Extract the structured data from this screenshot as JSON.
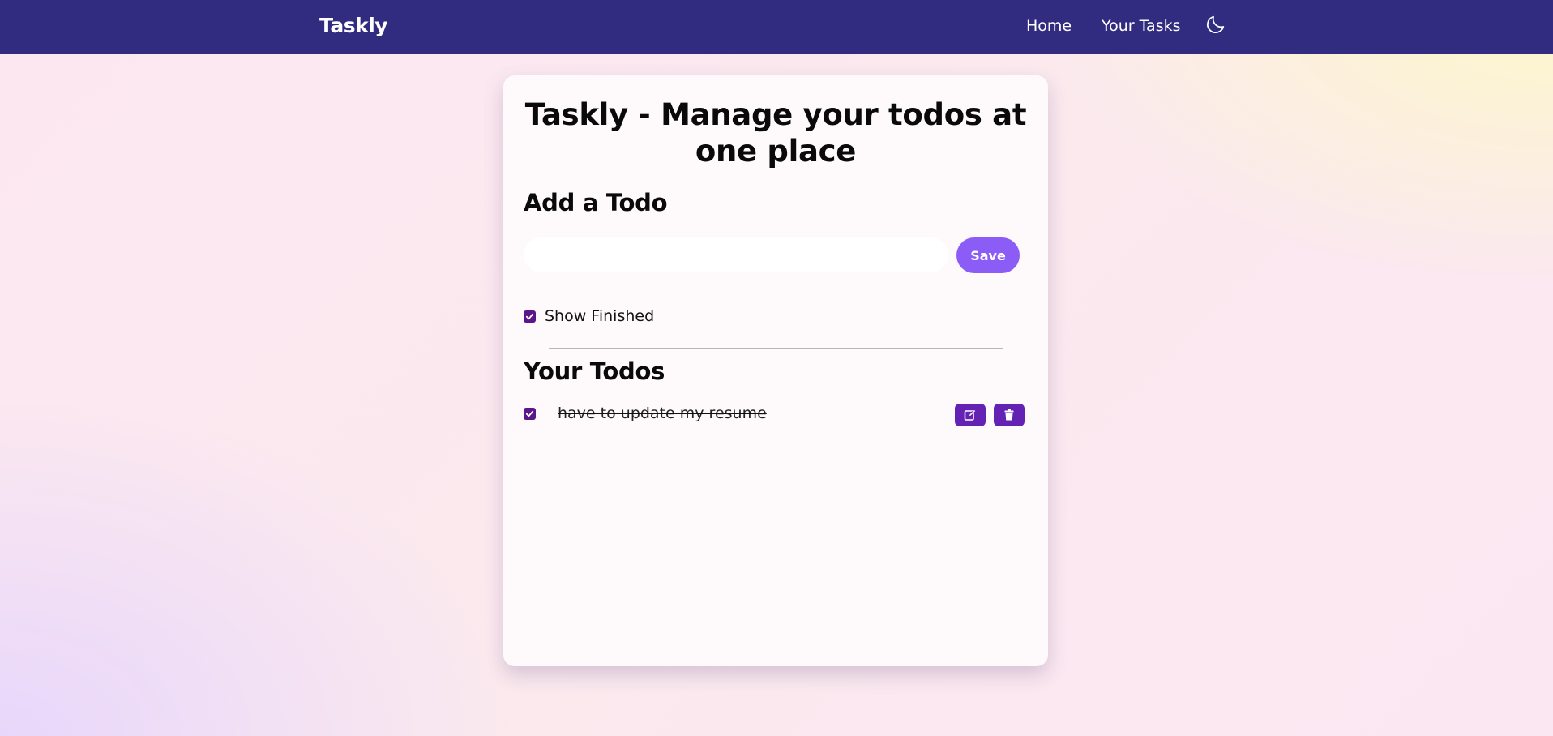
{
  "navbar": {
    "brand": "Taskly",
    "links": [
      {
        "label": "Home"
      },
      {
        "label": "Your Tasks"
      }
    ],
    "theme_toggle_icon": "moon-icon",
    "background_color": "#312c80"
  },
  "main": {
    "title": "Taskly - Manage your todos at one place",
    "add_section": {
      "heading": "Add a Todo",
      "input_value": "",
      "input_placeholder": "",
      "save_label": "Save"
    },
    "show_finished": {
      "label": "Show Finished",
      "checked": true
    },
    "todos_section": {
      "heading": "Your Todos",
      "items": [
        {
          "text": "have to update my resume",
          "completed": true,
          "edit_icon": "edit-icon",
          "delete_icon": "trash-icon"
        }
      ]
    }
  },
  "colors": {
    "accent": "#8b5cf6",
    "action_button": "#6322b4",
    "checkbox": "#5b168c"
  }
}
